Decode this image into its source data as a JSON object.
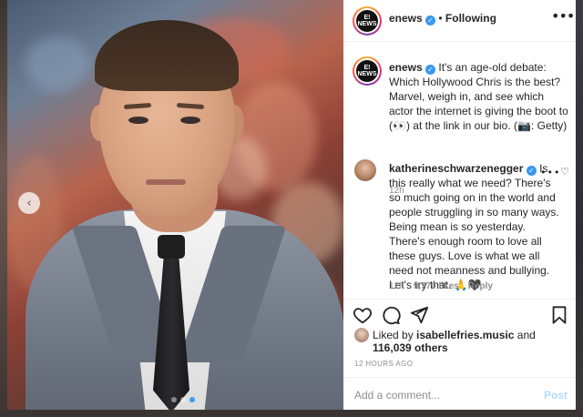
{
  "post": {
    "author": "enews",
    "follow_state": "Following",
    "dot": "•",
    "avatar_logo": "E! NEWS",
    "more": "•••",
    "verified_mark": "✓"
  },
  "caption": {
    "username": "enews",
    "text": "It's an age-old debate: Which Hollywood Chris is the best? Marvel, weigh in, and see which actor the internet is giving the boot to (👀) at the link in our bio. (📷: Getty)",
    "time": "12h"
  },
  "comment": {
    "username": "katherineschwarzenegger",
    "text": "Is this really what we need? There's so much going on in the world and people struggling in so many ways. Being mean is so yesterday. There's enough room to love all these guys. Love is what we all need not meanness and bullying. Let's try that. 🙏🖤",
    "time": "12h",
    "likes": "9,770 likes",
    "reply": "Reply",
    "more": "•••",
    "heart": "♡"
  },
  "likes": {
    "prefix": "Liked by",
    "user": "isabellefries.music",
    "conj": "and",
    "others": "116,039 others"
  },
  "post_time": "12 HOURS AGO",
  "add_comment": {
    "placeholder": "Add a comment...",
    "post_label": "Post"
  },
  "carousel": {
    "prev": "‹",
    "slide_count": 3,
    "active_slide": 3
  },
  "colors": {
    "verified": "#3897f0",
    "post_button_disabled": "#b3dbff",
    "active_dot": "#3d9cf0"
  },
  "icons": [
    "heart-icon",
    "comment-icon",
    "share-icon",
    "bookmark-icon",
    "chevron-left-icon"
  ]
}
